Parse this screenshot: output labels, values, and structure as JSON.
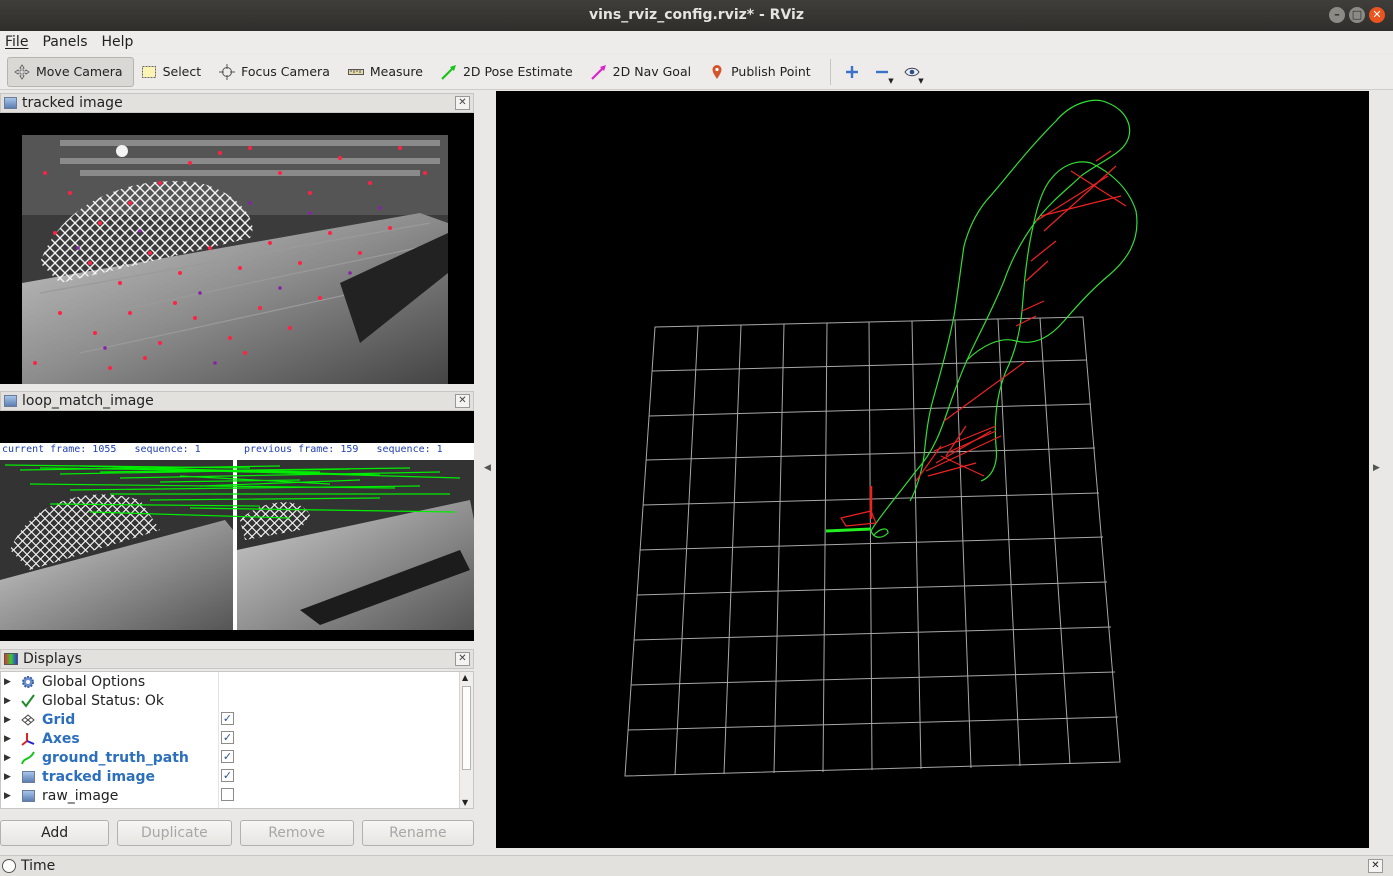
{
  "window": {
    "title": "vins_rviz_config.rviz* - RViz"
  },
  "menu": [
    "File",
    "Panels",
    "Help"
  ],
  "toolbar": {
    "tools": [
      {
        "label": "Move Camera",
        "icon": "move-camera-icon",
        "active": true
      },
      {
        "label": "Select",
        "icon": "select-icon"
      },
      {
        "label": "Focus Camera",
        "icon": "focus-camera-icon"
      },
      {
        "label": "Measure",
        "icon": "measure-icon"
      },
      {
        "label": "2D Pose Estimate",
        "icon": "pose-estimate-icon"
      },
      {
        "label": "2D Nav Goal",
        "icon": "nav-goal-icon"
      },
      {
        "label": "Publish Point",
        "icon": "publish-point-icon"
      }
    ]
  },
  "panels": {
    "tracked": {
      "title": "tracked image"
    },
    "loop": {
      "title": "loop_match_image",
      "current_label": "current frame: 1055   sequence: 1",
      "previous_label": "previous frame: 159   sequence: 1"
    },
    "displays": {
      "title": "Displays"
    },
    "time": {
      "title": "Time"
    }
  },
  "displays": {
    "items": [
      {
        "label": "Global Options",
        "icon": "gear-icon",
        "style": "normal",
        "checkbox": null
      },
      {
        "label": "Global Status: Ok",
        "icon": "checkmark-icon",
        "style": "normal",
        "checkbox": null
      },
      {
        "label": "Grid",
        "icon": "grid-icon",
        "style": "blue",
        "checkbox": true
      },
      {
        "label": "Axes",
        "icon": "axes-icon",
        "style": "blue",
        "checkbox": true
      },
      {
        "label": "ground_truth_path",
        "icon": "path-icon",
        "style": "blue",
        "checkbox": true
      },
      {
        "label": "tracked image",
        "icon": "image-icon",
        "style": "blue",
        "checkbox": true
      },
      {
        "label": "raw_image",
        "icon": "image-icon",
        "style": "normal",
        "checkbox": false
      }
    ]
  },
  "buttons": {
    "add": "Add",
    "duplicate": "Duplicate",
    "remove": "Remove",
    "rename": "Rename"
  },
  "colors": {
    "path_green": "#33dd33",
    "loop_red": "#ee2222",
    "feature_red": "#ff2244",
    "grid": "#b0b0b0",
    "label_blue": "#1f3fb3"
  }
}
